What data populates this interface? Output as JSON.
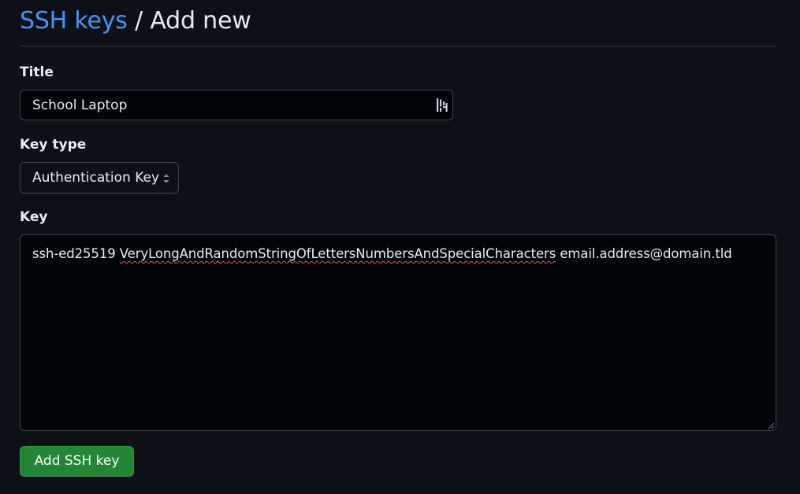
{
  "breadcrumb": {
    "link_label": "SSH keys",
    "separator": " / ",
    "current": "Add new"
  },
  "form": {
    "title_label": "Title",
    "title_value": "School Laptop",
    "key_type_label": "Key type",
    "key_type_value": "Authentication Key",
    "key_label": "Key",
    "key_value_prefix": "ssh-ed25519 ",
    "key_value_misspelled": "VeryLongAndRandomStringOfLettersNumbersAndSpecialCharacters",
    "key_value_suffix": " email.address@domain.tld",
    "submit_label": "Add SSH key"
  },
  "colors": {
    "background": "#0d1117",
    "link": "#4493f8",
    "primary_button": "#238636",
    "border": "#3d444d"
  },
  "icons": {
    "title_field": "password-manager-icon",
    "select": "select-caret-icon",
    "textarea": "resize-grip-icon"
  }
}
